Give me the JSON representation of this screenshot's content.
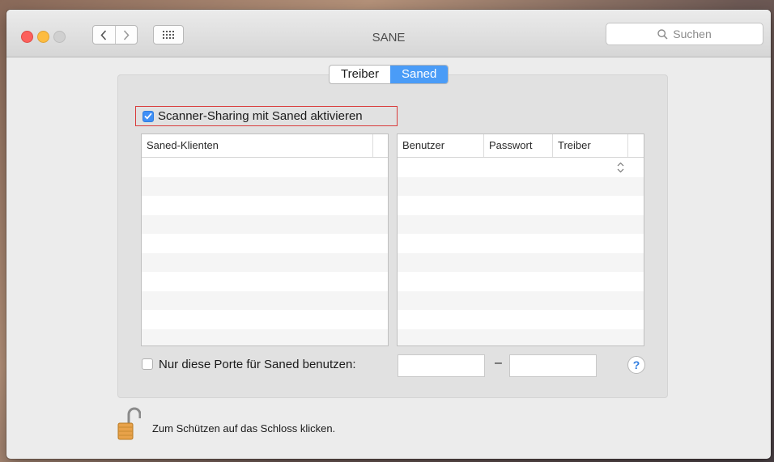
{
  "window": {
    "title": "SANE",
    "search_placeholder": "Suchen"
  },
  "tabs": [
    {
      "label": "Treiber",
      "active": false
    },
    {
      "label": "Saned",
      "active": true
    }
  ],
  "sharing": {
    "label": "Scanner-Sharing mit Saned aktivieren",
    "checked": true
  },
  "clients_table": {
    "columns": [
      "Saned-Klienten",
      ""
    ]
  },
  "users_table": {
    "columns": [
      "Benutzer",
      "Passwort",
      "Treiber",
      ""
    ]
  },
  "ports": {
    "label": "Nur diese Porte für Saned benutzen:",
    "checked": false,
    "from": "",
    "to": "",
    "separator": "–"
  },
  "help_label": "?",
  "lock_text": "Zum Schützen auf das Schloss klicken.",
  "colors": {
    "accent": "#4a9cf7",
    "highlight_border": "#d93b3b"
  }
}
